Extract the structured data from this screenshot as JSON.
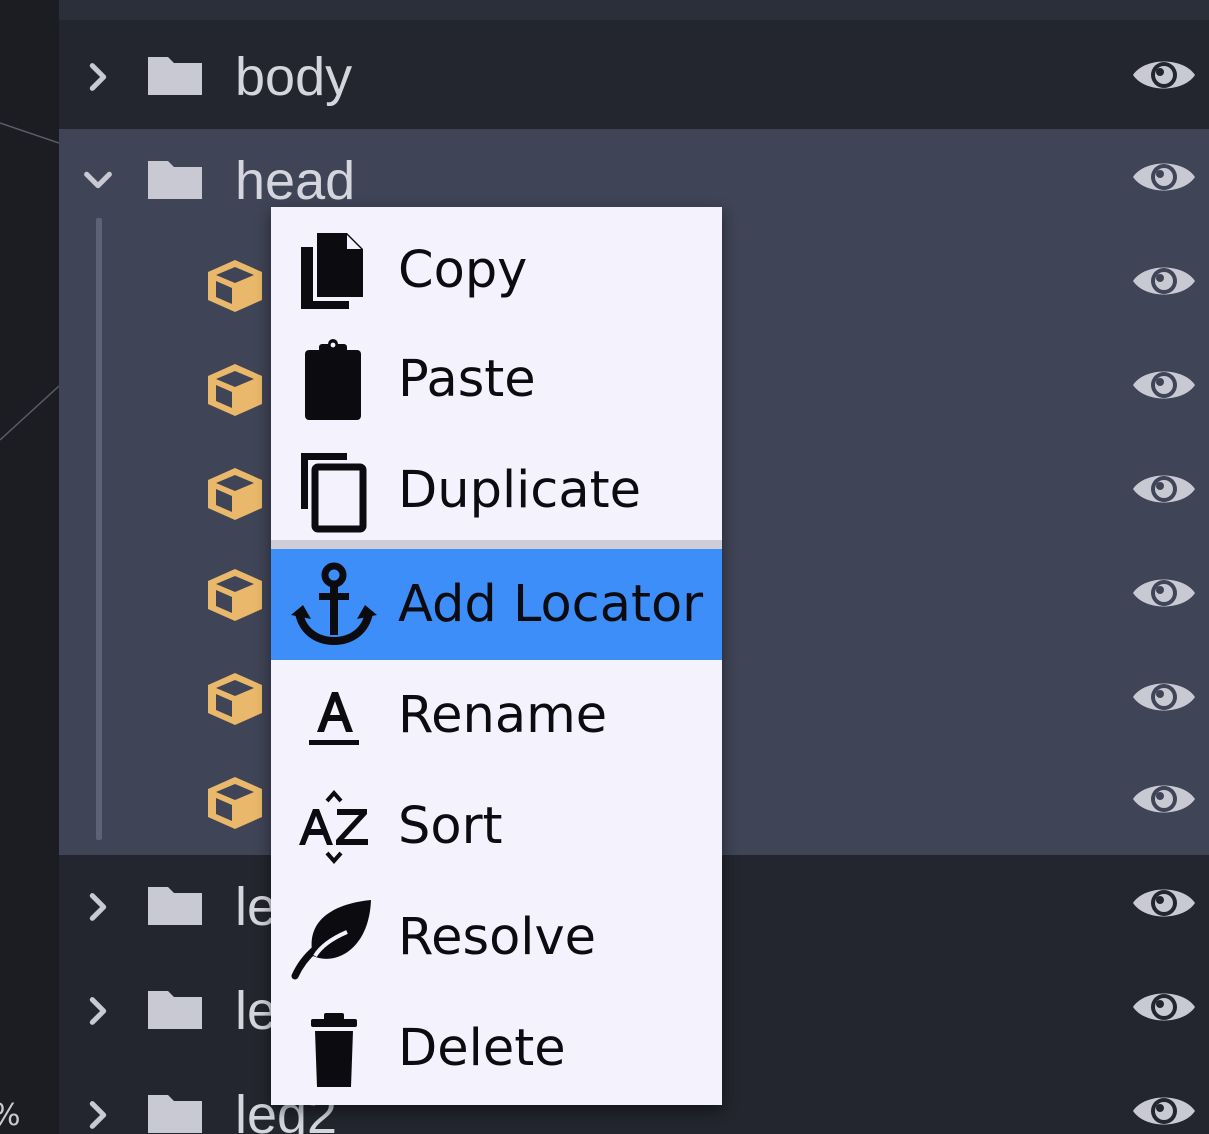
{
  "viewport": {
    "zoom_text": "%"
  },
  "outliner": {
    "rows": [
      {
        "label": "body",
        "kind": "group",
        "expanded": false,
        "icon": "folder-icon",
        "visible": true
      },
      {
        "label": "head",
        "kind": "group",
        "expanded": true,
        "icon": "folder-icon",
        "visible": true
      },
      {
        "label": "",
        "kind": "cube",
        "icon": "cube-icon",
        "visible": true
      },
      {
        "label": "",
        "kind": "cube",
        "icon": "cube-icon",
        "visible": true
      },
      {
        "label": "",
        "kind": "cube",
        "icon": "cube-icon",
        "visible": true
      },
      {
        "label": "",
        "kind": "cube",
        "icon": "cube-icon",
        "visible": true
      },
      {
        "label": "",
        "kind": "cube",
        "icon": "cube-icon",
        "visible": true
      },
      {
        "label": "",
        "kind": "cube",
        "icon": "cube-icon",
        "visible": true
      },
      {
        "label": "le",
        "kind": "group",
        "expanded": false,
        "icon": "folder-icon",
        "visible": true
      },
      {
        "label": "le",
        "kind": "group",
        "expanded": false,
        "icon": "folder-icon",
        "visible": true
      },
      {
        "label": "leg2",
        "kind": "group",
        "expanded": false,
        "icon": "folder-icon",
        "visible": true
      }
    ]
  },
  "context_menu": {
    "items": [
      {
        "label": "Copy",
        "icon": "copy-icon"
      },
      {
        "label": "Paste",
        "icon": "paste-icon"
      },
      {
        "label": "Duplicate",
        "icon": "duplicate-icon"
      },
      {
        "label": "Add Locator",
        "icon": "anchor-icon",
        "highlighted": true
      },
      {
        "label": "Rename",
        "icon": "rename-icon"
      },
      {
        "label": "Sort",
        "icon": "sort-az-icon"
      },
      {
        "label": "Resolve",
        "icon": "leaf-icon"
      },
      {
        "label": "Delete",
        "icon": "trash-icon"
      }
    ]
  },
  "colors": {
    "selection_bg": "#3f4456",
    "panel_bg": "#23262e",
    "menu_bg": "#f3f2fd",
    "menu_highlight": "#3d8ef8",
    "cube_icon": "#e9b86a",
    "icon_gray": "#c9c9d4"
  }
}
